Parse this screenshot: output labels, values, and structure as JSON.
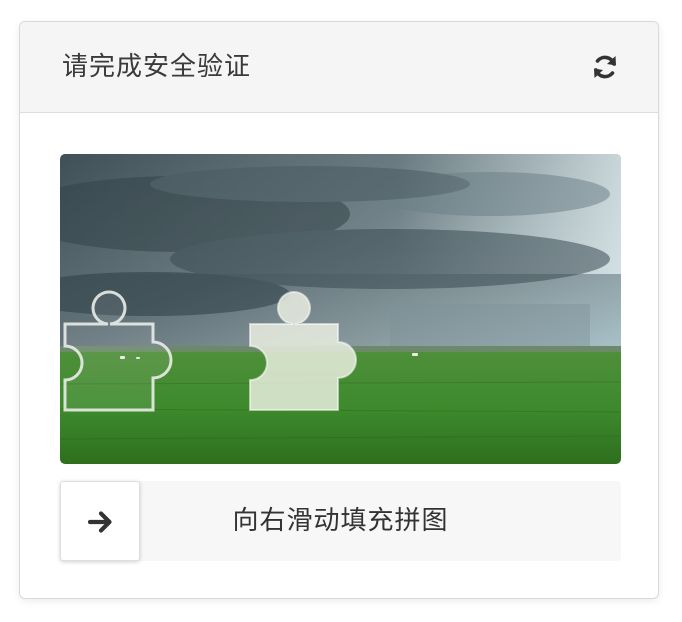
{
  "dialog": {
    "title": "请完成安全验证",
    "refresh_icon": "refresh-icon"
  },
  "slider": {
    "hint": "向右滑动填充拼图",
    "handle_icon": "arrow-right-icon"
  },
  "colors": {
    "header_bg": "#f5f5f5",
    "border": "#d9d9d9",
    "text": "#3a3a3a"
  }
}
